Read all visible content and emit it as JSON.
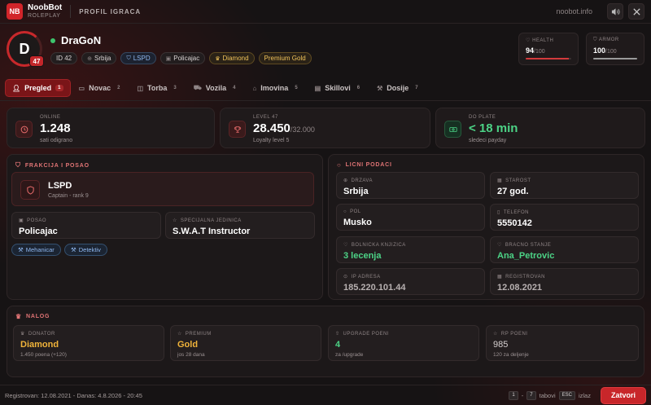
{
  "app": {
    "brand": "NoobBot",
    "brand_sub": "ROLEPLAY",
    "logo": "NB",
    "page_title": "PROFIL IGRACA",
    "site": "noobot.info"
  },
  "icons": {
    "sound": "speaker-icon",
    "close": "close-icon"
  },
  "player": {
    "initial": "D",
    "level": "47",
    "name": "DraGoN",
    "chips": [
      {
        "label": "ID 42"
      },
      {
        "label": "Srbija"
      },
      {
        "label": "LSPD"
      },
      {
        "label": "Policajac"
      },
      {
        "label": "Diamond"
      },
      {
        "label": "Premium Gold"
      }
    ]
  },
  "health": {
    "label": "HEALTH",
    "value": "94",
    "max": "/100",
    "fill": 0.94
  },
  "armor": {
    "label": "ARMOR",
    "value": "100",
    "max": "/100",
    "fill": 1.0
  },
  "tabs": [
    {
      "label": "Pregled",
      "num": "1"
    },
    {
      "label": "Novac",
      "num": "2"
    },
    {
      "label": "Torba",
      "num": "3"
    },
    {
      "label": "Vozila",
      "num": "4"
    },
    {
      "label": "Imovina",
      "num": "5"
    },
    {
      "label": "Skillovi",
      "num": "6"
    },
    {
      "label": "Dosije",
      "num": "7"
    }
  ],
  "kpis": {
    "online": {
      "label": "ONLINE",
      "value": "1.248",
      "sub": "sati odigrano"
    },
    "level": {
      "label": "LEVEL 47",
      "value": "28.450",
      "value_max": "/32.000",
      "sub": "Loyalty level 5"
    },
    "payday": {
      "label": "DO PLATE",
      "value": "< 18 min",
      "sub": "sledeci payday"
    }
  },
  "frakcija": {
    "title": "FRAKCIJA I POSAO",
    "name": "LSPD",
    "rank": "Captain - rank 9",
    "posao_label": "POSAO",
    "posao_value": "Policajac",
    "unit_label": "SPECIJALNA JEDINICA",
    "unit_value": "S.W.A.T Instructor",
    "skills": [
      "Mehanicar",
      "Detektiv"
    ]
  },
  "licni": {
    "title": "LICNI PODACI",
    "fields": [
      {
        "label": "DRZAVA",
        "value": "Srbija"
      },
      {
        "label": "STAROST",
        "value": "27 god."
      },
      {
        "label": "POL",
        "value": "Musko"
      },
      {
        "label": "TELEFON",
        "value": "5550142"
      },
      {
        "label": "BOLNICKA KNJIZICA",
        "value": "3 lecenja"
      },
      {
        "label": "BRACNO STANJE",
        "value": "Ana_Petrovic"
      },
      {
        "label": "IP ADRESA",
        "value": "185.220.101.44"
      },
      {
        "label": "REGISTROVAN",
        "value": "12.08.2021"
      }
    ]
  },
  "nalog": {
    "title": "NALOG",
    "cards": [
      {
        "label": "DONATOR",
        "value": "Diamond",
        "sub": "1.450 poena (+120)"
      },
      {
        "label": "PREMIUM",
        "value": "Gold",
        "sub": "jos 28 dana"
      },
      {
        "label": "UPGRADE POENI",
        "value": "4",
        "sub": "za /upgrade"
      },
      {
        "label": "RP POENI",
        "value": "985",
        "sub": "120 za deljenje"
      }
    ]
  },
  "footer": {
    "left": "Registrovan: 12.08.2021 - Danas: 4.8.2026 - 20:45",
    "key1": "1",
    "dash": "-",
    "key7": "7",
    "tabovi": "tabovi",
    "esc": "ESC",
    "izlaz": "izlaz",
    "close_button": "Zatvori"
  },
  "colors": {
    "accent": "#c8262a",
    "green": "#4cd386",
    "gold": "#f0b33a",
    "blue": "#8fb8f0",
    "background": "#161314"
  }
}
